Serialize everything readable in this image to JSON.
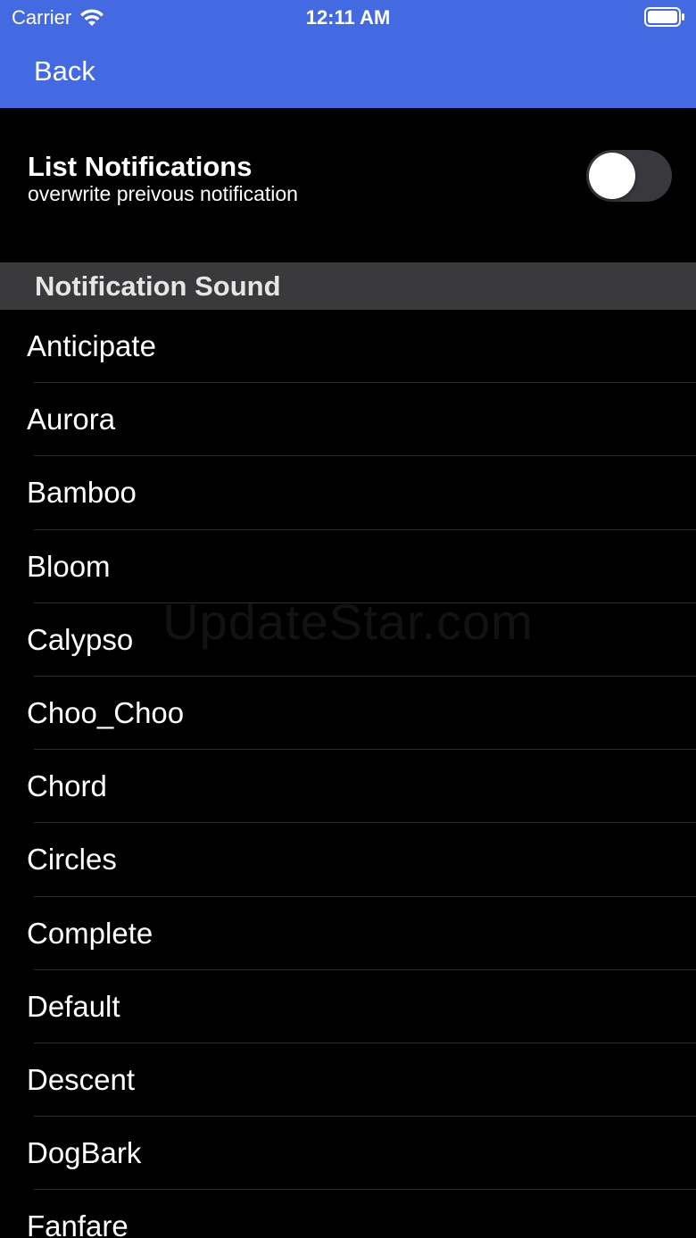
{
  "status_bar": {
    "carrier": "Carrier",
    "time": "12:11 AM",
    "wifi_icon": "wifi-icon",
    "battery_icon": "battery-icon"
  },
  "nav": {
    "back_label": "Back",
    "background_color": "#436ae0"
  },
  "list_notifications": {
    "title": "List Notifications",
    "subtitle": "overwrite preivous notification",
    "toggle_on": false
  },
  "sound_section": {
    "title": "Notification Sound",
    "items": [
      {
        "label": "Anticipate"
      },
      {
        "label": "Aurora"
      },
      {
        "label": "Bamboo"
      },
      {
        "label": "Bloom"
      },
      {
        "label": "Calypso"
      },
      {
        "label": "Choo_Choo"
      },
      {
        "label": "Chord"
      },
      {
        "label": "Circles"
      },
      {
        "label": "Complete"
      },
      {
        "label": "Default"
      },
      {
        "label": "Descent"
      },
      {
        "label": "DogBark"
      },
      {
        "label": "Fanfare"
      }
    ]
  },
  "watermark": "UpdateStar.com"
}
